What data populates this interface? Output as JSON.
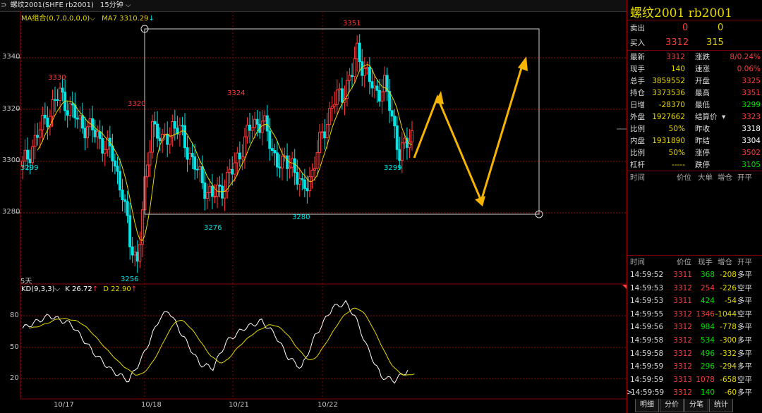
{
  "header": {
    "arrow": "⊃",
    "instrument": "螺纹2001(SHFE rb2001)",
    "period": "15分钟",
    "ma_combo_label": "MA组合(0,7,0,0,0,0)",
    "ma7_label": "MA7",
    "ma7_value": "3310.29",
    "ma7_arrow": "↓"
  },
  "main_chart": {
    "y_labels": [
      "3340",
      "3320",
      "3300",
      "3280"
    ],
    "annotations": [
      {
        "text": "3351",
        "kind": "high"
      },
      {
        "text": "3330",
        "kind": "high"
      },
      {
        "text": "3320",
        "kind": "high"
      },
      {
        "text": "3324",
        "kind": "high"
      },
      {
        "text": "3299",
        "kind": "low"
      },
      {
        "text": "3299",
        "kind": "low"
      },
      {
        "text": "3276",
        "kind": "low"
      },
      {
        "text": "3280",
        "kind": "low"
      },
      {
        "text": "3256",
        "kind": "low"
      }
    ],
    "days_label": "5天"
  },
  "kd_chart": {
    "label": "KD(9,3,3)",
    "k_label": "K",
    "k_value": "26.72",
    "k_arrow": "↑",
    "d_label": "D",
    "d_value": "22.90",
    "d_arrow": "↑",
    "y_labels": [
      "80",
      "50",
      "20"
    ]
  },
  "x_axis": {
    "dates": [
      "10/17",
      "10/18",
      "10/21",
      "10/22"
    ]
  },
  "panel": {
    "title": "螺纹2001 rb2001",
    "sell_label": "卖出",
    "sell_price": "0",
    "sell_vol": "0",
    "buy_label": "买入",
    "buy_price": "3312",
    "buy_vol": "315",
    "stats": [
      {
        "l1": "最新",
        "v1": "3312",
        "c1": "red",
        "l2": "涨跌",
        "v2": "8/0.24%",
        "c2": "red"
      },
      {
        "l1": "现手",
        "v1": "140",
        "c1": "yel",
        "l2": "速涨",
        "v2": "0.06%",
        "c2": "red"
      },
      {
        "l1": "总手",
        "v1": "3859552",
        "c1": "yel",
        "l2": "开盘",
        "v2": "3325",
        "c2": "red"
      },
      {
        "l1": "持仓",
        "v1": "3373536",
        "c1": "yel",
        "l2": "最高",
        "v2": "3351",
        "c2": "red"
      },
      {
        "l1": "日增",
        "v1": "-28370",
        "c1": "yel",
        "l2": "最低",
        "v2": "3299",
        "c2": "grn"
      },
      {
        "l1": "外盘",
        "v1": "1927662",
        "c1": "yel",
        "l2": "结算价",
        "v2": "3323",
        "c2": "red"
      },
      {
        "l1": "比例",
        "v1": "50%",
        "c1": "yel",
        "l2": "昨收",
        "v2": "3318",
        "c2": "wht"
      },
      {
        "l1": "内盘",
        "v1": "1931890",
        "c1": "yel",
        "l2": "昨结",
        "v2": "3304",
        "c2": "wht"
      },
      {
        "l1": "比例",
        "v1": "50%",
        "c1": "yel",
        "l2": "涨停",
        "v2": "3502",
        "c2": "red"
      },
      {
        "l1": "杠杆",
        "v1": "-----",
        "c1": "yel",
        "l2": "跌停",
        "v2": "3105",
        "c2": "grn"
      }
    ],
    "big_header": [
      "时间",
      "价位",
      "大单",
      "增仓",
      "开平"
    ],
    "trade_header": [
      "时间",
      "价位",
      "现手",
      "增仓",
      "开平"
    ],
    "trades": [
      {
        "t": "14:59:52",
        "p": "3311",
        "pc": "red",
        "v": "368",
        "vc": "grn",
        "d": "-208",
        "o": "多平"
      },
      {
        "t": "14:59:53",
        "p": "3312",
        "pc": "red",
        "v": "254",
        "vc": "red",
        "d": "-226",
        "o": "空平"
      },
      {
        "t": "14:59:53",
        "p": "3311",
        "pc": "red",
        "v": "424",
        "vc": "grn",
        "d": "-54",
        "o": "多平"
      },
      {
        "t": "14:59:55",
        "p": "3312",
        "pc": "red",
        "v": "1346",
        "vc": "red",
        "d": "-1044",
        "o": "空平"
      },
      {
        "t": "14:59:56",
        "p": "3312",
        "pc": "red",
        "v": "984",
        "vc": "grn",
        "d": "-778",
        "o": "多平"
      },
      {
        "t": "14:59:58",
        "p": "3312",
        "pc": "red",
        "v": "534",
        "vc": "grn",
        "d": "-300",
        "o": "多平"
      },
      {
        "t": "14:59:58",
        "p": "3312",
        "pc": "red",
        "v": "496",
        "vc": "grn",
        "d": "-332",
        "o": "多平"
      },
      {
        "t": "14:59:59",
        "p": "3312",
        "pc": "red",
        "v": "296",
        "vc": "grn",
        "d": "-294",
        "o": "多平"
      },
      {
        "t": "14:59:59",
        "p": "3313",
        "pc": "red",
        "v": "1078",
        "vc": "red",
        "d": "-658",
        "o": "空平"
      },
      {
        "t": "14:59:59",
        "p": "3312",
        "pc": "red",
        "v": "140",
        "vc": "grn",
        "d": "-60",
        "o": "多平"
      }
    ],
    "last_marker": ">"
  },
  "tabs": [
    "明细",
    "分价",
    "分笔",
    "统计"
  ],
  "colors": {
    "up": "#ff3b3b",
    "down": "#00e5e5",
    "ma": "#e6d800",
    "grid": "#8a0000",
    "arrow": "#f5b400"
  }
}
